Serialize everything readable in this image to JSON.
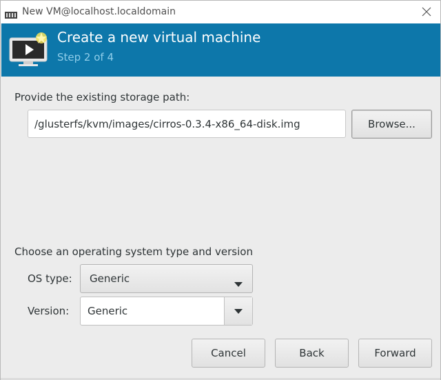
{
  "window": {
    "title": "New VM@localhost.localdomain",
    "app_icon": "virt-manager-icon",
    "close_icon": "close-icon"
  },
  "banner": {
    "title": "Create a new virtual machine",
    "step": "Step 2 of 4",
    "icon": "new-vm-icon",
    "background_color": "#0d77aa"
  },
  "storage": {
    "label": "Provide the existing storage path:",
    "path_value": "/glusterfs/kvm/images/cirros-0.3.4-x86_64-disk.img",
    "browse_label": "Browse..."
  },
  "os": {
    "section_label": "Choose an operating system type and version",
    "type_label": "OS type:",
    "type_value": "Generic",
    "version_label": "Version:",
    "version_value": "Generic"
  },
  "buttons": {
    "cancel": "Cancel",
    "back": "Back",
    "forward": "Forward"
  }
}
